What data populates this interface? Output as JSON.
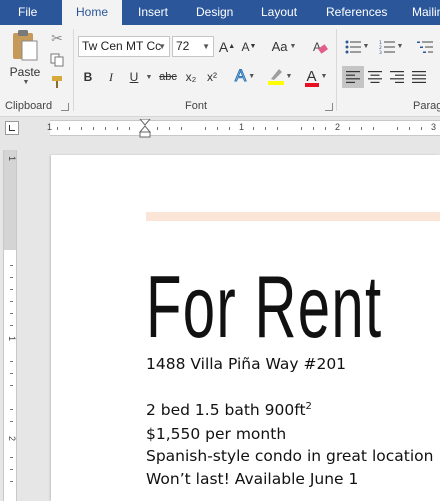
{
  "tabs": [
    "File",
    "Home",
    "Insert",
    "Design",
    "Layout",
    "References",
    "Mailings"
  ],
  "active_tab": "Home",
  "clipboard": {
    "paste_label": "Paste",
    "group_label": "Clipboard"
  },
  "font": {
    "font_name": "Tw Cen MT Cc",
    "font_size": "72",
    "grow_label": "A",
    "shrink_label": "A",
    "case_label": "Aa",
    "bold": "B",
    "italic": "I",
    "underline": "U",
    "strike": "abc",
    "subscript": "x₂",
    "superscript": "x²",
    "effects_label": "A",
    "font_color_label": "A",
    "group_label": "Font"
  },
  "paragraph": {
    "group_label": "Parag"
  },
  "colors": {
    "ribbon_blue": "#2b579a",
    "accent_bar": "#fbe5d6",
    "highlight": "#ffff00",
    "font_color": "#e81123"
  },
  "ruler": {
    "h_numbers": [
      "1",
      "1",
      "2",
      "3"
    ],
    "v_numbers": [
      "1",
      "1",
      "2"
    ]
  },
  "document": {
    "title": "For Rent",
    "address": "1488 Villa Piña Way #201",
    "line_beds": "2 bed 1.5 bath 900ft",
    "line_beds_sup": "2",
    "line_price": "$1,550 per month",
    "line_style": "Spanish-style condo in great location",
    "line_avail": "Won’t last! Available June 1"
  }
}
